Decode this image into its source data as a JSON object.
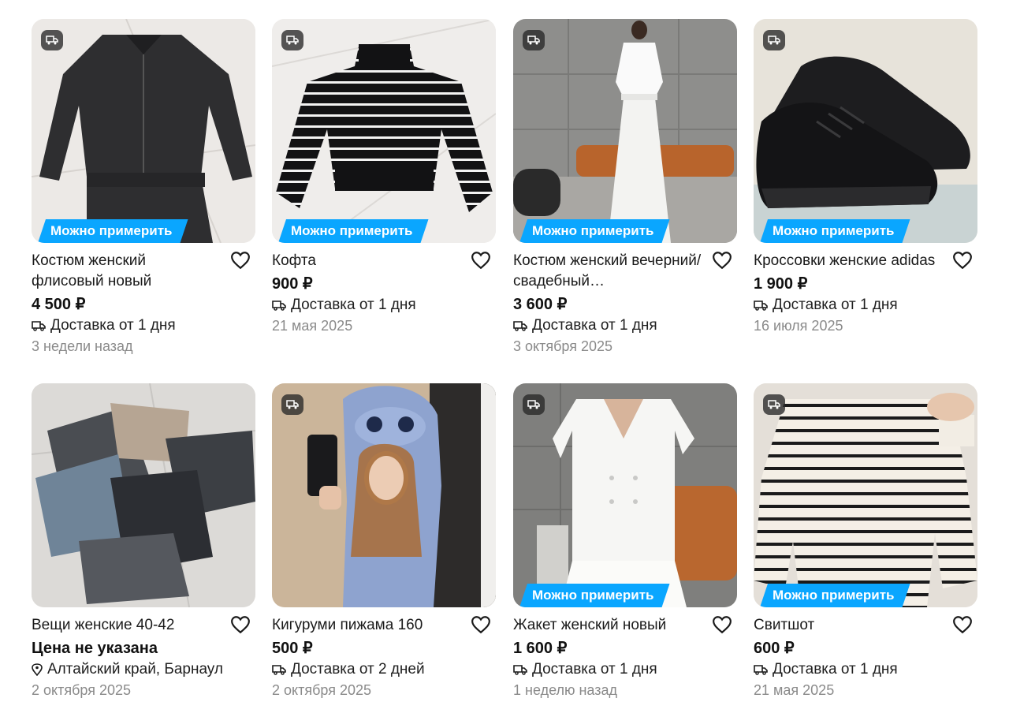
{
  "badge_label": "Можно примерить",
  "colors": {
    "accent": "#0aa6ff",
    "muted": "#8a8a8a"
  },
  "cards": [
    {
      "title": "Костюм женский флисовый новый",
      "price": "4 500 ₽",
      "meta": "Доставка от 1 дня",
      "meta_icon": "truck-icon",
      "date": "3 недели назад",
      "tryon": true,
      "truck_badge": true
    },
    {
      "title": "Кофта",
      "price": "900 ₽",
      "meta": "Доставка от 1 дня",
      "meta_icon": "truck-icon",
      "date": "21 мая 2025",
      "tryon": true,
      "truck_badge": true
    },
    {
      "title": "Костюм женский вечерний/свадебный…",
      "price": "3 600 ₽",
      "meta": "Доставка от 1 дня",
      "meta_icon": "truck-icon",
      "date": "3 октября 2025",
      "tryon": true,
      "truck_badge": true
    },
    {
      "title": "Кроссовки женские adidas",
      "price": "1 900 ₽",
      "meta": "Доставка от 1 дня",
      "meta_icon": "truck-icon",
      "date": "16 июля 2025",
      "tryon": true,
      "truck_badge": true
    },
    {
      "title": "Вещи женские 40-42",
      "price": "Цена не указана",
      "meta": "Алтайский край, Барнаул",
      "meta_icon": "location-pin-icon",
      "date": "2 октября 2025",
      "tryon": false,
      "truck_badge": false
    },
    {
      "title": "Кигуруми пижама 160",
      "price": "500 ₽",
      "meta": "Доставка от 2 дней",
      "meta_icon": "truck-icon",
      "date": "2 октября 2025",
      "tryon": false,
      "truck_badge": true
    },
    {
      "title": "Жакет женский новый",
      "price": "1 600 ₽",
      "meta": "Доставка от 1 дня",
      "meta_icon": "truck-icon",
      "date": "1 неделю назад",
      "tryon": true,
      "truck_badge": true
    },
    {
      "title": "Свитшот",
      "price": "600 ₽",
      "meta": "Доставка от 1 дня",
      "meta_icon": "truck-icon",
      "date": "21 мая 2025",
      "tryon": true,
      "truck_badge": true
    }
  ]
}
